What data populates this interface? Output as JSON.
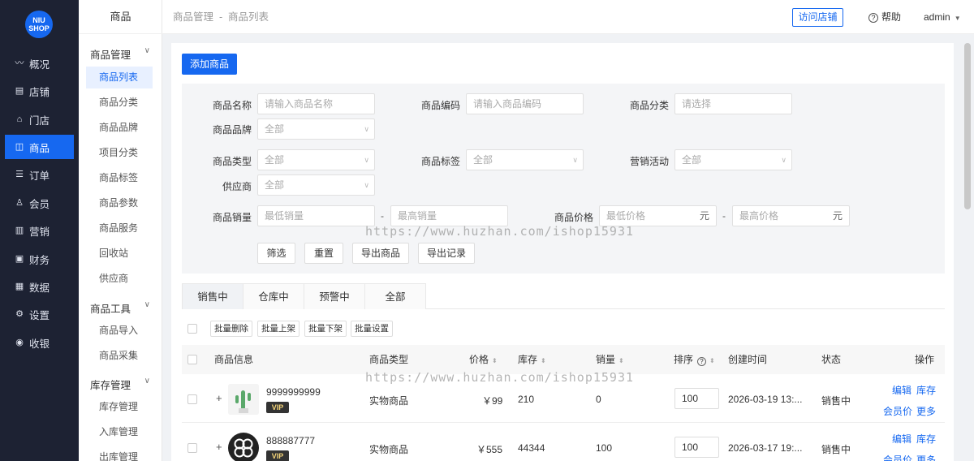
{
  "logo": {
    "line1": "NIU",
    "line2": "SHOP"
  },
  "nav": [
    {
      "label": "概况",
      "icon": "chart-line-icon"
    },
    {
      "label": "店铺",
      "icon": "store-icon"
    },
    {
      "label": "门店",
      "icon": "shop-front-icon"
    },
    {
      "label": "商品",
      "icon": "product-icon"
    },
    {
      "label": "订单",
      "icon": "order-icon"
    },
    {
      "label": "会员",
      "icon": "user-icon"
    },
    {
      "label": "营销",
      "icon": "marketing-icon"
    },
    {
      "label": "财务",
      "icon": "finance-icon"
    },
    {
      "label": "数据",
      "icon": "data-icon"
    },
    {
      "label": "设置",
      "icon": "gear-icon"
    },
    {
      "label": "收银",
      "icon": "cashier-icon"
    }
  ],
  "subnav": {
    "title": "商品",
    "group1": "商品管理",
    "group1_items": [
      "商品列表",
      "商品分类",
      "商品品牌",
      "项目分类",
      "商品标签",
      "商品参数",
      "商品服务",
      "回收站",
      "供应商"
    ],
    "group2": "商品工具",
    "group2_items": [
      "商品导入",
      "商品采集"
    ],
    "group3": "库存管理",
    "group3_items": [
      "库存管理",
      "入库管理",
      "出库管理"
    ]
  },
  "topbar": {
    "crumb": "商品管理  -  商品列表",
    "visit": "访问店铺",
    "help": "帮助",
    "user": "admin"
  },
  "add_button": "添加商品",
  "filter": {
    "name_label": "商品名称",
    "name_placeholder": "请输入商品名称",
    "code_label": "商品编码",
    "code_placeholder": "请输入商品编码",
    "category_label": "商品分类",
    "category_placeholder": "请选择",
    "brand_label": "商品品牌",
    "brand_value": "全部",
    "type_label": "商品类型",
    "type_value": "全部",
    "tag_label": "商品标签",
    "tag_value": "全部",
    "promo_label": "营销活动",
    "promo_value": "全部",
    "supplier_label": "供应商",
    "supplier_value": "全部",
    "sales_label": "商品销量",
    "sales_min": "最低销量",
    "sales_max": "最高销量",
    "price_label": "商品价格",
    "price_min": "最低价格",
    "price_max": "最高价格",
    "unit": "元",
    "dash": "-",
    "btn_filter": "筛选",
    "btn_reset": "重置",
    "btn_export": "导出商品",
    "btn_records": "导出记录"
  },
  "tabs": [
    "销售中",
    "仓库中",
    "预警中",
    "全部"
  ],
  "batch": [
    "批量删除",
    "批量上架",
    "批量下架",
    "批量设置"
  ],
  "table": {
    "headers": {
      "info": "商品信息",
      "type": "商品类型",
      "price": "价格",
      "stock": "库存",
      "sales": "销量",
      "sort": "排序",
      "created": "创建时间",
      "status": "状态",
      "ops": "操作"
    },
    "rows": [
      {
        "name": "9999999999",
        "badge": "VIP",
        "type": "实物商品",
        "price": "￥99",
        "stock": "210",
        "sales": "0",
        "sort": "100",
        "created": "2026-03-19 13:...",
        "status": "销售中",
        "op1": "编辑",
        "op2": "库存",
        "op3": "会员价",
        "op4": "更多",
        "plus": "+"
      },
      {
        "name": "888887777",
        "badge": "VIP",
        "type": "实物商品",
        "price": "￥555",
        "stock": "44344",
        "sales": "100",
        "sort": "100",
        "created": "2026-03-17 19:...",
        "status": "销售中",
        "op1": "编辑",
        "op2": "库存",
        "op3": "会员价",
        "op4": "更多",
        "plus": "+"
      }
    ]
  },
  "watermark": "https://www.huzhan.com/ishop15931"
}
